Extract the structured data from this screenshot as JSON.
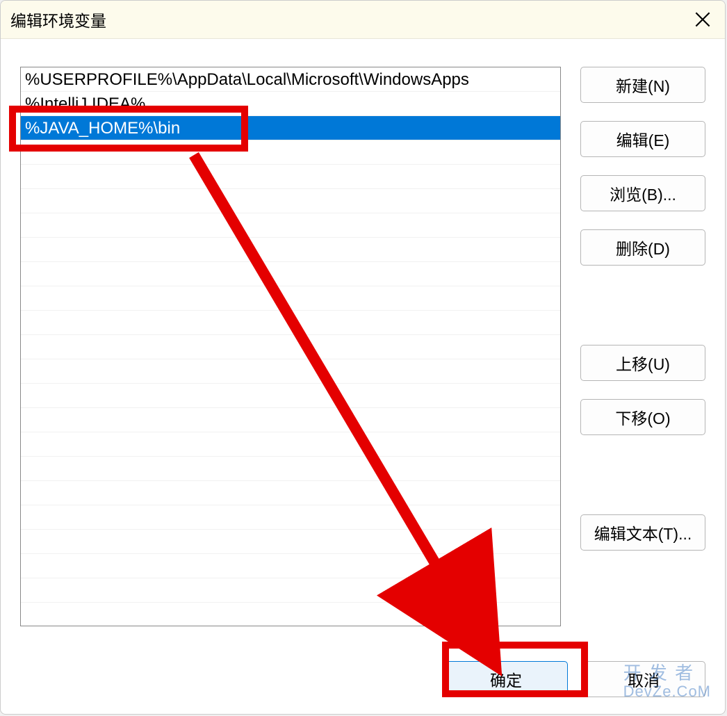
{
  "dialog": {
    "title": "编辑环境变量"
  },
  "list": {
    "rows": [
      {
        "value": "%USERPROFILE%\\AppData\\Local\\Microsoft\\WindowsApps",
        "selected": false
      },
      {
        "value": "%IntelliJ IDEA%",
        "selected": false
      },
      {
        "value": "%JAVA_HOME%\\bin",
        "selected": true
      }
    ],
    "empty_row_count": 20
  },
  "sidebar": {
    "new_label": "新建(N)",
    "edit_label": "编辑(E)",
    "browse_label": "浏览(B)...",
    "delete_label": "删除(D)",
    "moveup_label": "上移(U)",
    "movedown_label": "下移(O)",
    "edittext_label": "编辑文本(T)..."
  },
  "footer": {
    "ok_label": "确定",
    "cancel_label": "取消"
  },
  "watermark": {
    "line1": "开 发 者",
    "line2": "DevZe.CoM"
  },
  "annotations": {
    "highlight_row_index": 2,
    "highlight_ok": true,
    "arrow_from_to": true
  }
}
